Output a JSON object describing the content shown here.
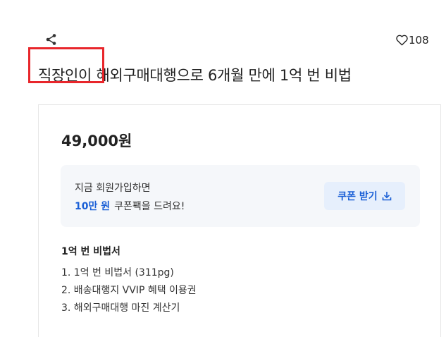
{
  "header": {
    "share_icon": "share-icon",
    "like_icon": "heart-outline-icon",
    "like_count": "108"
  },
  "product": {
    "title": "직장인이 해외구매대행으로 6개월 만에 1억 번 비법",
    "price": "49,000원"
  },
  "coupon": {
    "line1": "지금 회원가입하면",
    "amount": "10만 원",
    "line2_rest": "쿠폰팩을 드려요!",
    "button_label": "쿠폰 받기",
    "button_icon": "download-icon"
  },
  "bundle": {
    "title": "1억 번 비법서",
    "items": [
      "1. 1억 번 비법서 (311pg)",
      "2. 배송대행지 VVIP 혜택 이용권",
      "3. 해외구매대행 마진 계산기"
    ]
  },
  "colors": {
    "accent_blue": "#1a5fd6",
    "highlight_red": "#e8262b",
    "coupon_bg": "#f5f7fa",
    "coupon_button_bg": "#e6effc"
  }
}
